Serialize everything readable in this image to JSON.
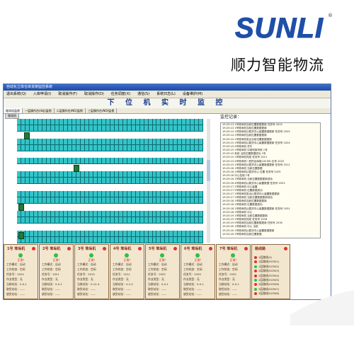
{
  "brand": {
    "logo_text": "SUNLI",
    "reg": "®",
    "subtitle": "顺力智能物流"
  },
  "app": {
    "title": "自动化立体仓库货架监控系统",
    "menu": [
      "退出系统(Q)",
      "入库申请(I)",
      "取消操作(F)",
      "取消操作(D)",
      "任务调度(X)",
      "通信(S)",
      "系统日志(L)",
      "设备维护(M)"
    ],
    "heading": "下 位 机 实 时 监 控",
    "tabs": [
      "堆垛机监视",
      "一层操作台(4站)监视",
      "二层操作台(NO)监视",
      "三层操作台(NO)监视"
    ],
    "subtab": "堆垛机",
    "monitor_title": "监控记录：",
    "log": [
      "19:25:13 1号堆垛机当前位置数据更新 任务号 2022",
      "19:25:13 1号堆垛机当前位置数据更新",
      "19:25:14 1号堆垛机以载货中心装置数据更新 任务号 2025",
      "19:25:14 1号堆垛机当前位置数据更新",
      "19:25:14 1号堆垛机发出当前位置数据更新",
      "19:25:15 1号堆垛机以载货中心装置数据更新 任务号 2024",
      "19:25:15 4号堆垛机 货叉",
      "19:25:15 1号堆垛机 中继机架号码 1号",
      "19:25:15 系统 当前位置数据成功 1号",
      "19:25:15 1号堆垛机完成 任务号 2011",
      "19:25:15 4号堆垛机一层的出库架(18:56) 位号 2022",
      "19:25:15 1号堆垛机以载货中心装置数据更新 任务号 2011",
      "19:25:16 1号堆垛机 当前位置数据",
      "19:25:16 1号堆垛机以载货中心 位置 任务号 2029",
      "19:25:16 中心控制 1号",
      "19:25:16 1号堆垛机 当前位置数据更新成功",
      "19:25:16 4号堆垛机以载货中心装置数据 任务号 2023",
      "19:25:17 1号堆垛机 中心装置",
      "19:25:17 5号堆垛机 位置数据成功",
      "19:25:17 1号堆垛机发出以载货中心装置数据更新",
      "19:25:17 1号堆垛机 当前位置数据更新成功",
      "19:25:18 1号堆垛机当前位置数据更新",
      "19:25:18 1号堆垛机 位置数据成功",
      "19:25:18 1号堆垛机以载货中心装置数据更新 任务号 2031",
      "19:25:18 1号堆垛机 中心",
      "19:25:19 1号堆垛机 当前位置数据更新",
      "19:25:19 1号堆垛机完成 任务号 2018",
      "19:25:19 5号堆垛机当前位置数据更新 任务号 2030",
      "19:25:20 1号堆垛机 中心 当前",
      "19:25:20 1号堆垛机以载货中心装置数据更新",
      "19:25:20 2号堆垛机当前位置数据"
    ],
    "machines": [
      {
        "title": "1号 堆垛机",
        "state": "正常！",
        "mode_label": "工作模式：",
        "mode": "自动",
        "status_label": "工作状态：",
        "status": "空闲",
        "task_label": "任务号：",
        "task": "2024",
        "type_label": "作业类型：",
        "type": "无",
        "pos_label": "当前站址：",
        "pos": "0-0-1",
        "take_label": "取货站址：",
        "take": "-----",
        "put_label": "放货站址：",
        "put": "-----"
      },
      {
        "title": "2号 堆垛机",
        "state": "正常！",
        "mode_label": "工作模式：",
        "mode": "自动",
        "status_label": "工作状态：",
        "status": "空闲",
        "task_label": "任务号：",
        "task": "2021",
        "type_label": "作业类型：",
        "type": "无",
        "pos_label": "当前站址：",
        "pos": "0-0-1",
        "take_label": "取货站址：",
        "take": "-----",
        "put_label": "放货站址：",
        "put": "-----"
      },
      {
        "title": "3号 堆垛机",
        "state": "正常！",
        "mode_label": "工作模式：",
        "mode": "自动",
        "status_label": "工作状态：",
        "status": "空闲",
        "task_label": "任务号：",
        "task": "2015",
        "type_label": "作业类型：",
        "type": "无",
        "pos_label": "当前站址：",
        "pos": "0-12-4",
        "take_label": "取货站址：",
        "take": "-----",
        "put_label": "放货站址：",
        "put": "-----"
      },
      {
        "title": "4号 堆垛机",
        "state": "正常！",
        "mode_label": "工作模式：",
        "mode": "自动",
        "status_label": "工作状态：",
        "status": "空闲",
        "task_label": "任务号：",
        "task": "2011",
        "type_label": "作业类型：",
        "type": "无",
        "pos_label": "当前站址：",
        "pos": "0-2-2",
        "take_label": "取货站址：",
        "take": "-----",
        "put_label": "放货站址：",
        "put": "-----"
      },
      {
        "title": "5号 堆垛机",
        "state": "正常！",
        "mode_label": "工作模式：",
        "mode": "自动",
        "status_label": "工作状态：",
        "status": "空闲",
        "task_label": "任务号：",
        "task": "2025",
        "type_label": "作业类型：",
        "type": "无",
        "pos_label": "当前站址：",
        "pos": "0-0-1",
        "take_label": "取货站址：",
        "take": "-----",
        "put_label": "放货站址：",
        "put": "-----"
      },
      {
        "title": "6号 堆垛机",
        "state": "正常！",
        "mode_label": "工作模式：",
        "mode": "自动",
        "status_label": "工作状态：",
        "status": "空闲",
        "task_label": "任务号：",
        "task": "2029",
        "type_label": "作业类型：",
        "type": "无",
        "pos_label": "当前站址：",
        "pos": "0-0-1",
        "take_label": "取货站址：",
        "take": "-----",
        "put_label": "放货站址：",
        "put": "-----"
      },
      {
        "title": "7号 堆垛机",
        "state": "正常！",
        "mode_label": "工作模式：",
        "mode": "自动",
        "status_label": "工作状态：",
        "status": "空闲",
        "task_label": "任务号：",
        "task": "2032",
        "type_label": "作业类型：",
        "type": "无",
        "pos_label": "当前站址：",
        "pos": "0-0-1",
        "take_label": "取货站址：",
        "take": "-----",
        "put_label": "放货站址：",
        "put": "-----"
      }
    ],
    "alarm": {
      "title": "路线路",
      "items": [
        "1层路线(4)",
        "1层路线(SCR01)",
        "1层路线(SCR02)",
        "2层路线(SCR03)",
        "2层路线(SCR04)",
        "2层路线(SCR05)",
        "3层路线(SCR06)",
        "3层路线(SCR07)",
        "3层路线(SCR08)"
      ]
    }
  },
  "colors": {
    "rack": "#33c4c8",
    "rack_border": "#0c6b70",
    "panel": "#f3e6cf",
    "ok_led": "#2ec23e",
    "alarm_led": "#e23030"
  }
}
